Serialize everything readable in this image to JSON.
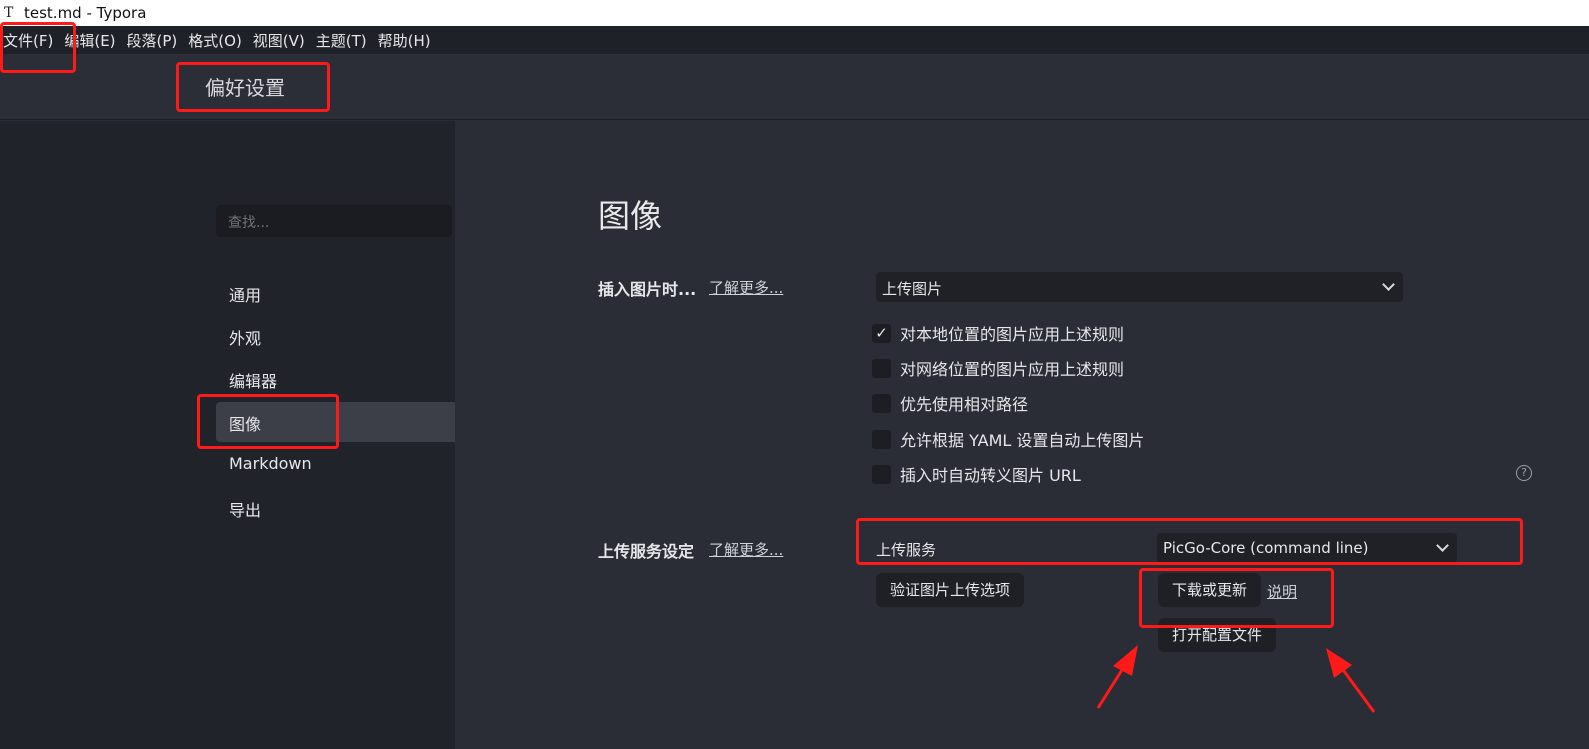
{
  "window": {
    "title": "test.md - Typora",
    "app_icon": "T"
  },
  "menubar": {
    "items": [
      "文件(F)",
      "编辑(E)",
      "段落(P)",
      "格式(O)",
      "视图(V)",
      "主题(T)",
      "帮助(H)"
    ]
  },
  "header": {
    "title": "偏好设置"
  },
  "sidebar": {
    "search_placeholder": "查找...",
    "items": [
      "通用",
      "外观",
      "编辑器",
      "图像",
      "Markdown",
      "导出"
    ],
    "active_item": "图像"
  },
  "main": {
    "title": "图像",
    "insert_image": {
      "label": "插入图片时...",
      "learn_more": "了解更多...",
      "selected_option": "上传图片"
    },
    "checkboxes": [
      {
        "label": "对本地位置的图片应用上述规则",
        "checked": true,
        "mark": "✓"
      },
      {
        "label": "对网络位置的图片应用上述规则",
        "checked": false
      },
      {
        "label": "优先使用相对路径",
        "checked": false
      },
      {
        "label": "允许根据 YAML 设置自动上传图片",
        "checked": false
      },
      {
        "label": "插入时自动转义图片 URL",
        "checked": false
      }
    ],
    "help_icon": "?",
    "upload_service": {
      "label": "上传服务设定",
      "learn_more": "了解更多...",
      "service_label": "上传服务",
      "selected_service": "PicGo-Core (command line)",
      "verify_button": "验证图片上传选项",
      "download_button": "下载或更新",
      "docs_link": "说明",
      "open_config_button": "打开配置文件"
    }
  },
  "colors": {
    "annotation": "#ff1a1a",
    "background": "#2a2d35",
    "sidebar": "#20232a",
    "menubar": "#1f2128"
  }
}
